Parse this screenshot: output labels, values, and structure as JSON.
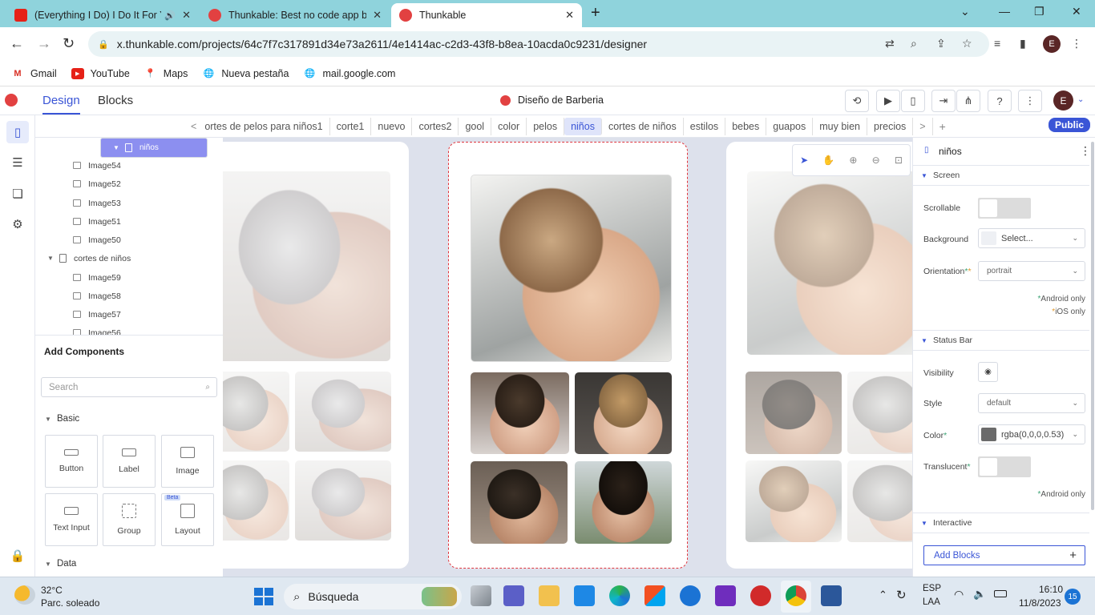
{
  "browser": {
    "tabs": [
      {
        "title": "(Everything I Do) I Do It For Y",
        "favicon": "youtube-icon",
        "color": "#e62117",
        "audio": true
      },
      {
        "title": "Thunkable: Best no code app buil",
        "favicon": "thunkable-icon",
        "color": "#e24141"
      },
      {
        "title": "Thunkable",
        "favicon": "thunkable-icon",
        "color": "#e24141",
        "active": true
      }
    ],
    "new_tab": "+",
    "url": "x.thunkable.com/projects/64c7f7c317891d34e73a2611/4e1414ac-c2d3-43f8-b8ea-10acda0c9231/designer",
    "profile_initial": "E",
    "bookmarks": [
      {
        "label": "Gmail",
        "icon": "gmail-icon"
      },
      {
        "label": "YouTube",
        "icon": "youtube-icon"
      },
      {
        "label": "Maps",
        "icon": "maps-icon"
      },
      {
        "label": "Nueva pestaña",
        "icon": "globe-icon"
      },
      {
        "label": "mail.google.com",
        "icon": "globe-icon"
      }
    ]
  },
  "app": {
    "tabs": {
      "design": "Design",
      "blocks": "Blocks"
    },
    "project_name": "Diseño de Barberia",
    "avatar_initial": "E",
    "screens": [
      "<",
      "ortes de pelos para niños1",
      "corte1",
      "nuevo",
      "cortes2",
      "gool",
      "color",
      "pelos",
      "niños",
      "cortes de niños",
      "estilos",
      "bebes",
      "guapos",
      "muy bien",
      "precios",
      ">"
    ],
    "active_screen": "niños",
    "add_screen": "+",
    "public_label": "Public",
    "accent": "#3a55d6"
  },
  "tree": {
    "rows": [
      {
        "label": "niños",
        "kind": "screen",
        "selected": true
      },
      {
        "label": "Image54",
        "kind": "image"
      },
      {
        "label": "Image52",
        "kind": "image"
      },
      {
        "label": "Image53",
        "kind": "image"
      },
      {
        "label": "Image51",
        "kind": "image"
      },
      {
        "label": "Image50",
        "kind": "image"
      },
      {
        "label": "cortes de niños",
        "kind": "screen"
      },
      {
        "label": "Image59",
        "kind": "image"
      },
      {
        "label": "Image58",
        "kind": "image"
      },
      {
        "label": "Image57",
        "kind": "image"
      },
      {
        "label": "Image56",
        "kind": "image"
      }
    ]
  },
  "components": {
    "title": "Add Components",
    "search_placeholder": "Search",
    "basic_label": "Basic",
    "data_label": "Data",
    "items": [
      {
        "label": "Button"
      },
      {
        "label": "Label"
      },
      {
        "label": "Image"
      },
      {
        "label": "Text Input"
      },
      {
        "label": "Group"
      },
      {
        "label": "Layout",
        "badge": "Beta"
      }
    ]
  },
  "props": {
    "component_name": "niños",
    "screen_section": "Screen",
    "scrollable_label": "Scrollable",
    "background_label": "Background",
    "background_value": "Select...",
    "orientation_label": "Orientation",
    "orientation_value": "portrait",
    "android_only": "Android only",
    "ios_only": "iOS only",
    "statusbar_section": "Status Bar",
    "visibility_label": "Visibility",
    "style_label": "Style",
    "style_value": "default",
    "color_label": "Color",
    "color_value": "rgba(0,0,0,0.53)",
    "translucent_label": "Translucent",
    "interactive_section": "Interactive",
    "add_blocks": "Add Blocks"
  },
  "taskbar": {
    "weather_temp": "32°C",
    "weather_desc": "Parc. soleado",
    "search_label": "Búsqueda",
    "lang_top": "ESP",
    "lang_bottom": "LAA",
    "time": "16:10",
    "date": "11/8/2023",
    "notif_count": "15"
  }
}
